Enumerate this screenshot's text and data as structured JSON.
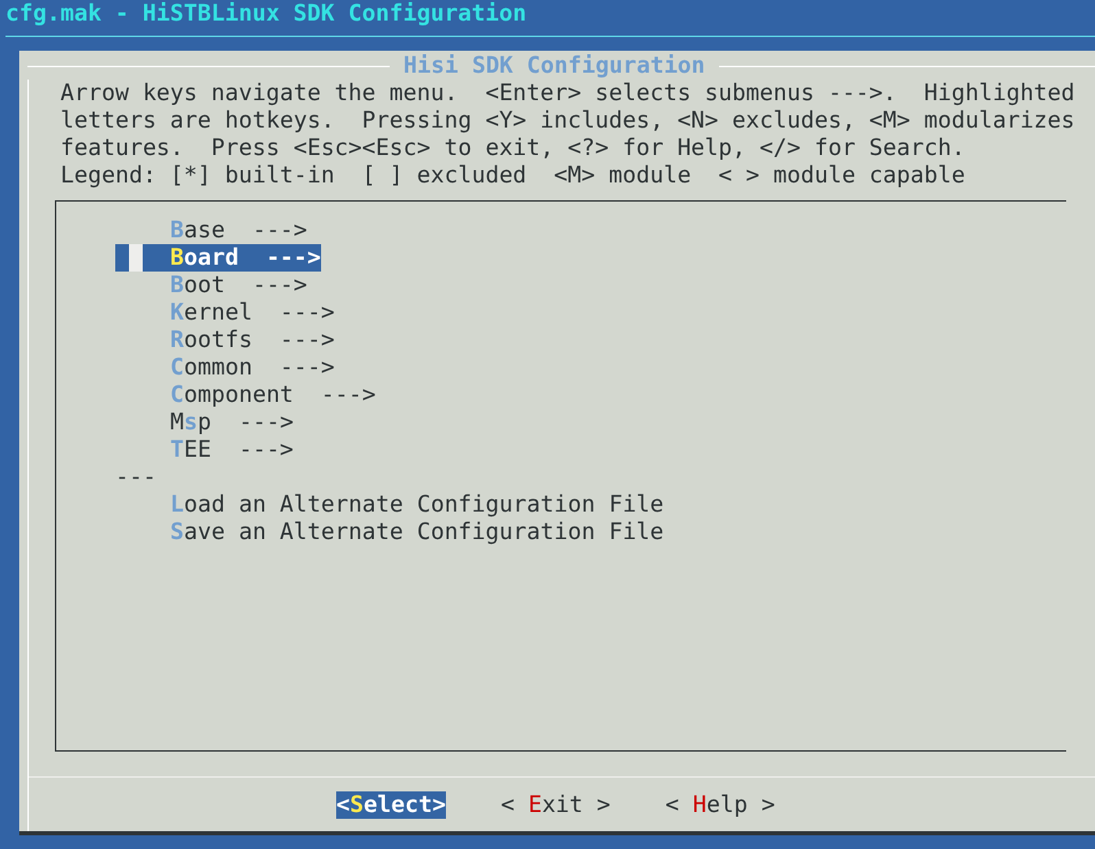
{
  "window": {
    "title": "cfg.mak - HiSTBLinux SDK Configuration"
  },
  "dialog": {
    "title": "Hisi SDK Configuration",
    "help_lines": [
      "Arrow keys navigate the menu.  <Enter> selects submenus --->.  Highlighted",
      "letters are hotkeys.  Pressing <Y> includes, <N> excludes, <M> modularizes",
      "features.  Press <Esc><Esc> to exit, <?> for Help, </> for Search.",
      "Legend: [*] built-in  [ ] excluded  <M> module  < > module capable"
    ]
  },
  "menu": [
    {
      "kind": "item",
      "hotkey": "B",
      "after": "ase  --->",
      "selected": false
    },
    {
      "kind": "item",
      "hotkey": "B",
      "after": "oard  --->",
      "selected": true
    },
    {
      "kind": "item",
      "hotkey": "B",
      "after": "oot  --->",
      "selected": false
    },
    {
      "kind": "item",
      "hotkey": "K",
      "after": "ernel  --->",
      "selected": false
    },
    {
      "kind": "item",
      "hotkey": "R",
      "after": "ootfs  --->",
      "selected": false
    },
    {
      "kind": "item",
      "hotkey": "C",
      "after": "ommon  --->",
      "selected": false
    },
    {
      "kind": "item",
      "hotkey": "C",
      "after": "omponent  --->",
      "selected": false
    },
    {
      "kind": "item",
      "before": "M",
      "hotkey": "s",
      "after": "p  --->",
      "selected": false
    },
    {
      "kind": "item",
      "hotkey": "T",
      "after": "EE  --->",
      "selected": false
    },
    {
      "kind": "separator",
      "text": "---"
    },
    {
      "kind": "item",
      "hotkey": "L",
      "after": "oad an Alternate Configuration File",
      "selected": false
    },
    {
      "kind": "item",
      "hotkey": "S",
      "after": "ave an Alternate Configuration File",
      "selected": false
    }
  ],
  "buttons": [
    {
      "before": "<",
      "hotkey": "S",
      "after": "elect>",
      "selected": true
    },
    {
      "before": "< ",
      "hotkey": "E",
      "after": "xit >",
      "selected": false
    },
    {
      "before": "< ",
      "hotkey": "H",
      "after": "elp >",
      "selected": false
    }
  ]
}
